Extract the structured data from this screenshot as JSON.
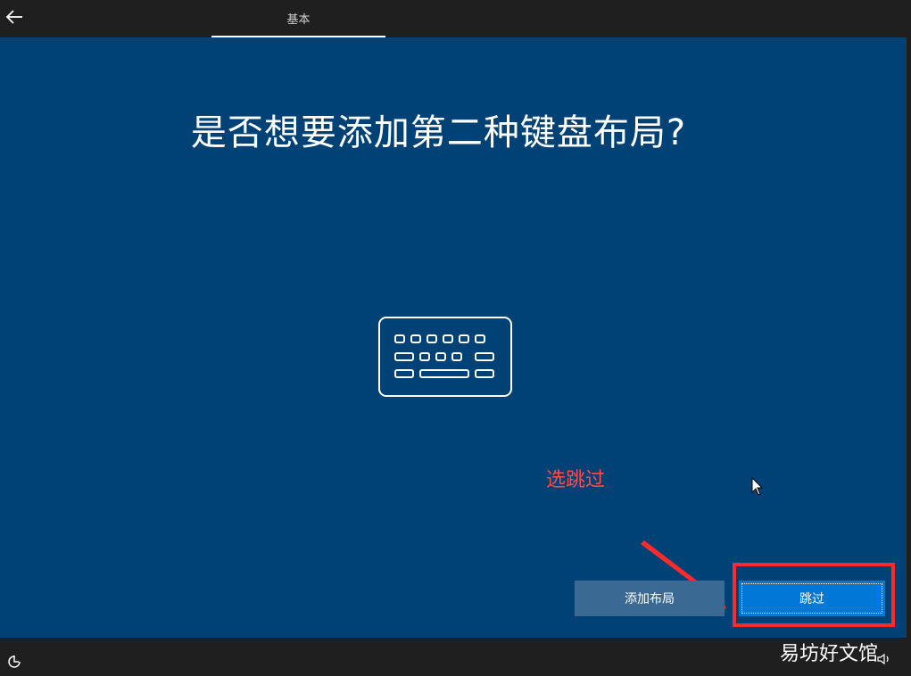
{
  "header": {
    "tab_label": "基本"
  },
  "main": {
    "title": "是否想要添加第二种键盘布局?"
  },
  "annotation": {
    "text": "选跳过",
    "color": "#ff4a4a"
  },
  "buttons": {
    "add_layout": "添加布局",
    "skip": "跳过"
  },
  "watermark": {
    "text": "易坊好文馆"
  },
  "colors": {
    "background_blue": "#004275",
    "bar_dark": "#1f1f1f",
    "skip_button": "#0078d7",
    "add_button": "#3a6a94",
    "highlight_red": "#ff2a2a"
  },
  "icons": [
    "back-arrow-icon",
    "keyboard-icon",
    "cursor-icon",
    "accessibility-icon",
    "volume-icon"
  ]
}
